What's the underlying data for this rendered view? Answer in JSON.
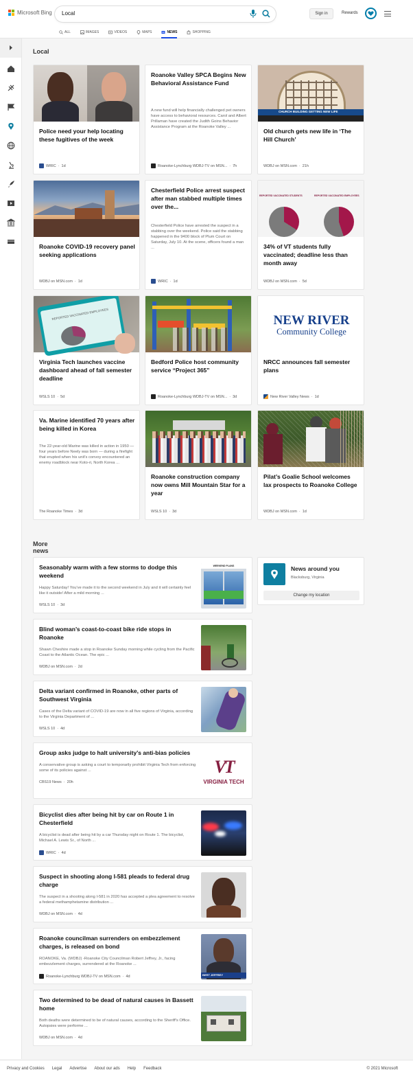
{
  "header": {
    "brand": "Microsoft Bing",
    "search_value": "Local",
    "sign_in": "Sign in",
    "rewards": "Rewards",
    "tabs": [
      {
        "label": "ALL"
      },
      {
        "label": "IMAGES"
      },
      {
        "label": "VIDEOS"
      },
      {
        "label": "MAPS"
      },
      {
        "label": "NEWS"
      },
      {
        "label": "SHOPPING"
      }
    ]
  },
  "sidebar": {
    "icons": [
      "expand-icon",
      "home-icon",
      "science-icon",
      "flag-icon",
      "location-icon",
      "globe-icon",
      "microscope-icon",
      "rocket-icon",
      "video-icon",
      "politics-icon",
      "money-icon"
    ]
  },
  "local": {
    "title": "Local",
    "cards": [
      {
        "title": "Police need your help locating these fugitives of the week",
        "snippet": "",
        "source": "WRIC",
        "age": "1d"
      },
      {
        "title": "Roanoke Valley SPCA Begins New Behavioral Assistance Fund",
        "snippet": "A new fund will help financially challenged pet owners have access to behavioral resources. Carol and Albert Prillaman have created the Judith Goins Behavior Assistance Program at the Roanoke Valley ...",
        "source": "Roanoke-Lynchburg WDBJ-TV on MSN...",
        "age": "7h"
      },
      {
        "title": "Old church gets new life in ‘The Hill Church’",
        "snippet": "",
        "source": "WDBJ on MSN.com",
        "age": "21h",
        "img_caption": "CHURCH BUILDING GETTING NEW LIFE"
      },
      {
        "title": "Roanoke COVID-19 recovery panel seeking applications",
        "snippet": "",
        "source": "WDBJ on MSN.com",
        "age": "1d"
      },
      {
        "title": "Chesterfield Police arrest suspect after man stabbed multiple times over the...",
        "snippet": "Chesterfield Police have arrested the suspect in a stabbing over the weekend. Police said the stabbing happened in the 9400 block of Plum Court on Saturday, July 10. At the scene, officers found a man ...",
        "source": "WRIC",
        "age": "1d"
      },
      {
        "title": "34% of VT students fully vaccinated; deadline less than month away",
        "snippet": "",
        "source": "WDBJ on MSN.com",
        "age": "5d",
        "img_labels": [
          "REPORTED VACCINATED STUDENTS",
          "REPORTED VACCINATED EMPLOYEES"
        ]
      },
      {
        "title": "Virginia Tech launches vaccine dashboard ahead of fall semester deadline",
        "snippet": "",
        "source": "WSLS 10",
        "age": "5d",
        "img_caption": "REPORTED VACCINATED EMPLOYEES"
      },
      {
        "title": "Bedford Police host community service “Project 365”",
        "snippet": "",
        "source": "Roanoke-Lynchburg WDBJ-TV on MSN...",
        "age": "3d"
      },
      {
        "title": "NRCC announces fall semester plans",
        "snippet": "",
        "source": "New River Valley News",
        "age": "1d",
        "logo_line1": "NEW RIVER",
        "logo_line2": "Community College"
      },
      {
        "title": "Va. Marine identified 70 years after being killed in Korea",
        "snippet": "The 22-year-old Marine was killed in action in 1950 — four years before Neely was born — during a firefight that erupted when his unit's convoy encountered an enemy roadblock near Koto-ri, North Korea ...",
        "source": "The Roanoke Times",
        "age": "3d"
      },
      {
        "title": "Roanoke construction company now owns Mill Mountain Star for a year",
        "snippet": "",
        "source": "WSLS 10",
        "age": "3d"
      },
      {
        "title": "Pilat’s Goalie School welcomes lax prospects to Roanoke College",
        "snippet": "",
        "source": "WDBJ on MSN.com",
        "age": "1d"
      }
    ]
  },
  "more": {
    "title": "More news",
    "items": [
      {
        "title": "Seasonably warm with a few storms to dodge this weekend",
        "snippet": "Happy Saturday! You've made it to the second weekend in July and it will certainly feel like it outside! After a mild morning ...",
        "source": "WSLS 10",
        "age": "3d",
        "thumb_caption": "WEEKEND PLANS"
      },
      {
        "title": "Blind woman’s coast-to-coast bike ride stops in Roanoke",
        "snippet": "Shawn Cheshire made a stop in Roanoke Sunday morning while cycling from the Pacific Coast to the Atlantic Ocean. The epic ...",
        "source": "WDBJ on MSN.com",
        "age": "2d"
      },
      {
        "title": "Delta variant confirmed in Roanoke, other parts of Southwest Virginia",
        "snippet": "Cases of the Delta variant of COVID-19 are now in all five regions of Virginia, according to the Virginia Department of ...",
        "source": "WSLS 10",
        "age": "4d"
      },
      {
        "title": "Group asks judge to halt university’s anti-bias policies",
        "snippet": "A conservative group is asking a court to temporarily prohibit Virginia Tech from enforcing some of its policies against ...",
        "source": "CBS19 News",
        "age": "20h",
        "thumb_logo": "VT",
        "thumb_text": "VIRGINIA TECH"
      },
      {
        "title": "Bicyclist dies after being hit by car on Route 1 in Chesterfield",
        "snippet": "A bicyclist is dead after being hit by a car Thursday night on Route 1. The bicyclist, Michael A. Lewis Sr., of North ...",
        "source": "WRIC",
        "age": "4d"
      },
      {
        "title": "Suspect in shooting along I-581 pleads to federal drug charge",
        "snippet": "The suspect in a shooting along I-581 in 2020 has accepted a plea agreement to resolve a federal methamphetamine distribution ...",
        "source": "WDBJ on MSN.com",
        "age": "4d"
      },
      {
        "title": "Roanoke councilman surrenders on embezzlement charges, is released on bond",
        "snippet": "ROANOKE, Va. (WDBJ) -Roanoke City Councilman Robert Jeffrey, Jr., facing embezzlement charges, surrendered at the Roanoke ...",
        "source": "Roanoke-Lynchburg WDBJ-TV on MSN.com",
        "age": "4d",
        "thumb_caption": "BERT JEFFREY"
      },
      {
        "title": "Two determined to be dead of natural causes in Bassett home",
        "snippet": "Both deaths were determined to be of natural causes, according to the Sheriff's Office. Autopsies were performe ...",
        "source": "WDBJ on MSN.com",
        "age": "4d"
      }
    ],
    "around": {
      "title": "News around you",
      "location": "Blacksburg, Virginia",
      "button": "Change my location"
    }
  },
  "footer": {
    "links": [
      "Privacy and Cookies",
      "Legal",
      "Advertise",
      "About our ads",
      "Help",
      "Feedback"
    ],
    "copyright": "© 2021 Microsoft"
  },
  "colors": {
    "accent": "#174ae4",
    "teal": "#0f7fa1",
    "vt_maroon": "#861f41"
  }
}
